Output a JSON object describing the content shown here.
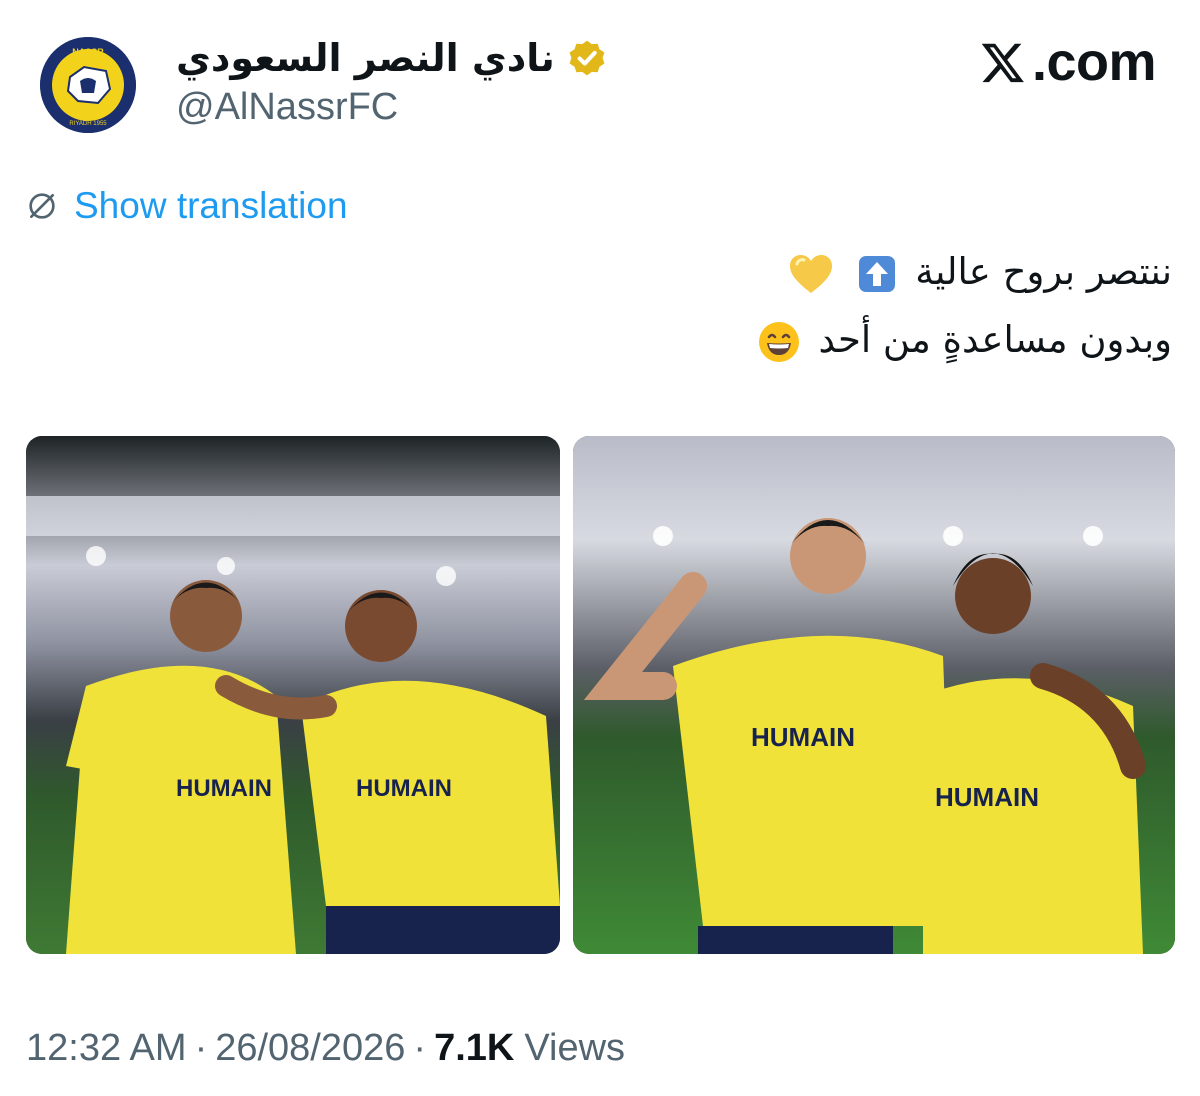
{
  "account": {
    "display_name": "نادي النصر السعودي",
    "handle": "@AlNassrFC",
    "verified": true,
    "verified_color": "#e2b719",
    "avatar_logo_text": "NASSR",
    "avatar_logo_subtext": "RIYADH 1955"
  },
  "brand": {
    "logo_text": ".com"
  },
  "translation": {
    "label": "Show translation"
  },
  "tweet": {
    "line1": "ننتصر بروح عالية",
    "line2": "وبدون مساعدةٍ من أحد",
    "line1_emojis": [
      "up-arrow-emoji",
      "yellow-heart-emoji"
    ],
    "line2_emojis": [
      "grinning-face-emoji"
    ]
  },
  "media": [
    {
      "description_icon": "photo-two-players-celebrating-left",
      "jersey_text": "HUMAIN",
      "jersey_color": "#f1e23a"
    },
    {
      "description_icon": "photo-two-players-celebrating-right",
      "jersey_text": "HUMAIN",
      "jersey_color": "#f1e23a"
    }
  ],
  "meta": {
    "time": "12:32 AM",
    "date": "26/08/2026",
    "views_count": "7.1K",
    "views_label": "Views",
    "separator": "·"
  },
  "colors": {
    "link": "#1d9bf0",
    "secondary_text": "#536471",
    "primary_text": "#0f1419",
    "club_navy": "#1b2f6e",
    "club_yellow": "#f3d21c"
  }
}
